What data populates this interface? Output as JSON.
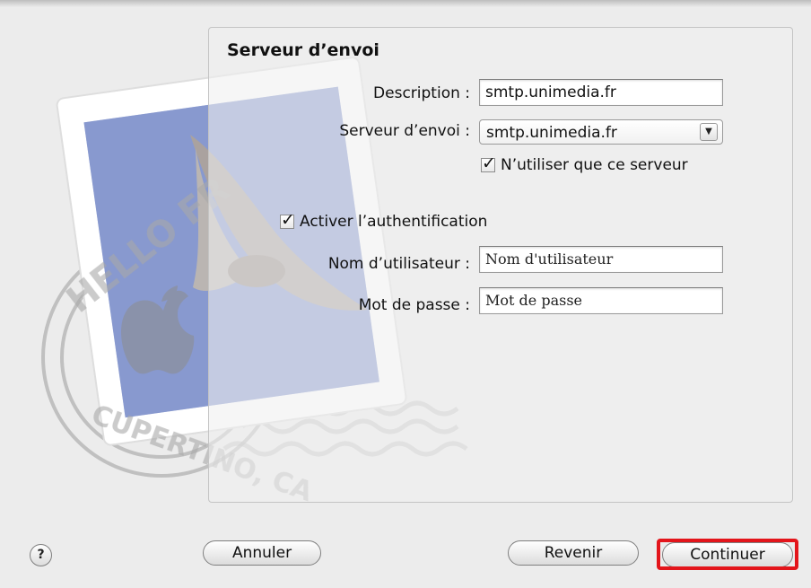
{
  "panel": {
    "title": "Serveur d’envoi"
  },
  "form": {
    "description_label": "Description :",
    "description_value": "smtp.unimedia.fr",
    "server_label": "Serveur d’envoi :",
    "server_value": "smtp.unimedia.fr",
    "only_server_label": "N’utiliser que ce serveur",
    "only_server_checked": true,
    "auth_label": "Activer l’authentification",
    "auth_checked": true,
    "username_label": "Nom d’utilisateur :",
    "username_value": "Nom d'utilisateur",
    "password_label": "Mot de passe :",
    "password_value": "Mot de passe"
  },
  "stamp": {
    "text_top": "HELLO FR",
    "text_bottom": "CUPERTINO, CA"
  },
  "buttons": {
    "help": "?",
    "cancel": "Annuler",
    "back": "Revenir",
    "continue": "Continuer"
  },
  "colors": {
    "highlight": "#e3151b"
  }
}
